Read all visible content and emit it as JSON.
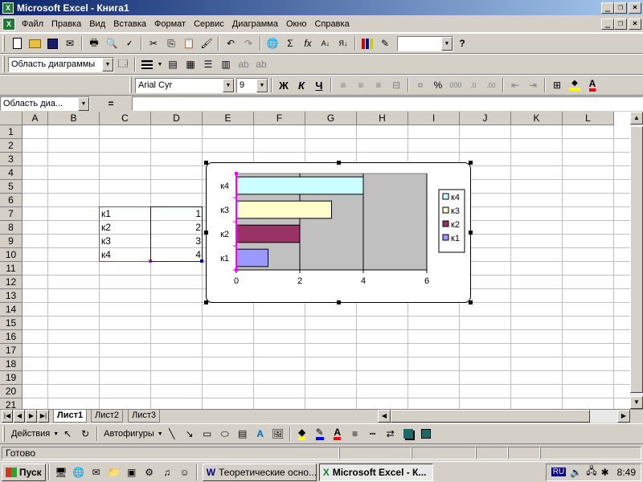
{
  "window": {
    "title": "Microsoft Excel - Книга1"
  },
  "menu": [
    "Файл",
    "Правка",
    "Вид",
    "Вставка",
    "Формат",
    "Сервис",
    "Диаграмма",
    "Окно",
    "Справка"
  ],
  "toolbar": {
    "zoom_value": "",
    "chart_object_select": "Область диаграммы"
  },
  "format_toolbar": {
    "font": "Arial Cyr",
    "size": "9",
    "bold": "Ж",
    "italic": "К",
    "underline": "Ч",
    "percent": "%",
    "thousands": "000"
  },
  "formula_bar": {
    "name_box": "Область диа...",
    "equals": "=",
    "value": ""
  },
  "columns": [
    "A",
    "B",
    "C",
    "D",
    "E",
    "F",
    "G",
    "H",
    "I",
    "J",
    "K",
    "L"
  ],
  "rows": [
    "1",
    "2",
    "3",
    "4",
    "5",
    "6",
    "7",
    "8",
    "9",
    "10",
    "11",
    "12",
    "13",
    "14",
    "15",
    "16",
    "17",
    "18",
    "19",
    "20",
    "21"
  ],
  "cells": {
    "b7": "к1",
    "b8": "к2",
    "b9": "к3",
    "b10": "к4",
    "c7": "1",
    "c8": "2",
    "c9": "3",
    "c10": "4"
  },
  "chart_data": {
    "type": "bar",
    "orientation": "horizontal",
    "categories": [
      "к1",
      "к2",
      "к3",
      "к4"
    ],
    "values": [
      1,
      2,
      3,
      4
    ],
    "colors": [
      "#9999ff",
      "#993366",
      "#ffffcc",
      "#ccffff"
    ],
    "xlim": [
      0,
      6
    ],
    "xticks": [
      "0",
      "2",
      "4",
      "6"
    ],
    "grid": true,
    "plot_area_color": "#c0c0c0",
    "legend": {
      "placement": "right",
      "entries": [
        "к4",
        "к3",
        "к2",
        "к1"
      ]
    },
    "title": "",
    "xlabel": "",
    "ylabel": ""
  },
  "sheets": {
    "tabs": [
      "Лист1",
      "Лист2",
      "Лист3"
    ],
    "active": "Лист1"
  },
  "drawing_toolbar": {
    "actions": "Действия",
    "autoshapes": "Автофигуры"
  },
  "status": {
    "text": "Готово"
  },
  "taskbar": {
    "start": "Пуск",
    "tasks": [
      "Теоретические осно...",
      "Microsoft Excel - К..."
    ],
    "lang": "RU",
    "clock": "8:49"
  }
}
